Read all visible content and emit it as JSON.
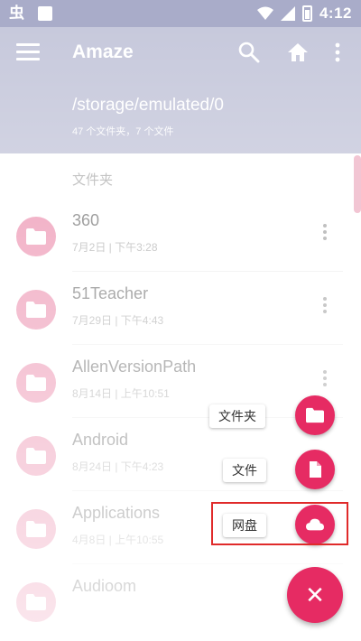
{
  "status_bar": {
    "left_glyph": "虫",
    "time": "4:12"
  },
  "app_bar": {
    "title": "Amaze",
    "path": "/storage/emulated/0",
    "summary": "47 个文件夹，7 个文件",
    "icons": [
      "menu-icon",
      "search-icon",
      "home-icon",
      "more-vert-icon"
    ]
  },
  "list": {
    "section_header": "文件夹",
    "items": [
      {
        "name": "360",
        "meta": "7月2日 | 下午3:28"
      },
      {
        "name": "51Teacher",
        "meta": "7月29日 | 下午4:43"
      },
      {
        "name": "AllenVersionPath",
        "meta": "8月14日 | 上午10:51"
      },
      {
        "name": "Android",
        "meta": "8月24日 | 下午4:23"
      },
      {
        "name": "Applications",
        "meta": "4月8日 | 上午10:55"
      },
      {
        "name": "Audioom",
        "meta": ""
      }
    ]
  },
  "fab_menu": {
    "items": [
      {
        "label": "文件夹",
        "icon": "folder-icon"
      },
      {
        "label": "文件",
        "icon": "file-icon"
      },
      {
        "label": "网盘",
        "icon": "cloud-icon"
      }
    ],
    "main_icon": "close-icon",
    "main_glyph": "✕"
  },
  "colors": {
    "app_bar": "#a9acc9",
    "accent": "#e62b63",
    "avatar": "#e4608c",
    "highlight": "#e02a2a"
  }
}
